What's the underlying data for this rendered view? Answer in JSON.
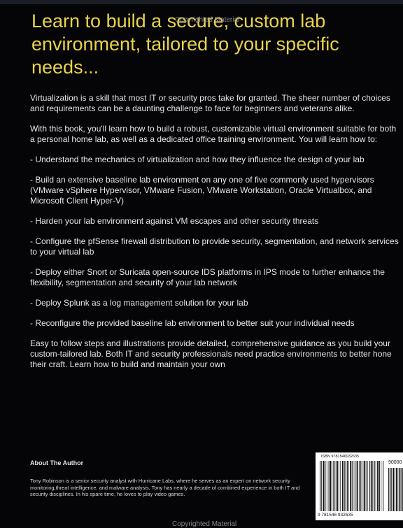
{
  "headline": "Learn to build a secure, custom lab environment, tailored to your specific needs...",
  "watermark_top": "Copyrighted Material",
  "watermark_bottom": "Copyrighted Material",
  "paragraphs": [
    "Virtualization is a skill that most IT or security pros take for granted. The sheer number of choices and requirements can be a daunting challenge to face for beginners and veterans alike.",
    "With this book, you'll learn how to build a robust, customizable virtual environment suitable for both a personal home lab, as well as a dedicated office training environment. You will learn how to:",
    "- Understand the mechanics of virtualization and how they influence the design of your lab",
    "- Build an extensive baseline lab environment on any one of five commonly used hypervisors (VMware vSphere Hypervisor, VMware Fusion, VMware Workstation, Oracle Virtualbox, and Microsoft Client Hyper-V)",
    "- Harden your lab environment against VM escapes and other security threats",
    "- Configure the pfSense firewall distribution to provide security, segmentation, and network services to your virtual lab",
    "- Deploy either Snort or Suricata open-source IDS platforms in IPS mode to further enhance the flexibility, segmentation and security of your lab network",
    "- Deploy Splunk as a log management solution for your lab",
    "- Reconfigure the provided baseline lab environment to better suit your individual needs",
    "Easy to follow steps and illustrations provide detailed, comprehensive guidance as you build your custom-tailored lab. Both IT and security professionals need practice environments to better hone their craft. Learn how to build and maintain your own"
  ],
  "about": {
    "heading": "About The Author",
    "text": "Tony Robinson is a senior security analyst with Hurricane Labs, where he serves as an expert on network security monitoring,threat intelligence, and malware analysis. Tony has nearly a decade of combined experience in both IT and security disciplines. In his spare time, he loves to play video games."
  },
  "barcode": {
    "isbn_label": "ISBN 9781546932635",
    "price_code": "90000",
    "digits": "9 781546 932635"
  },
  "colors": {
    "background": "#050507",
    "headline": "#e8d34a",
    "body_text": "#e6e6e6"
  }
}
